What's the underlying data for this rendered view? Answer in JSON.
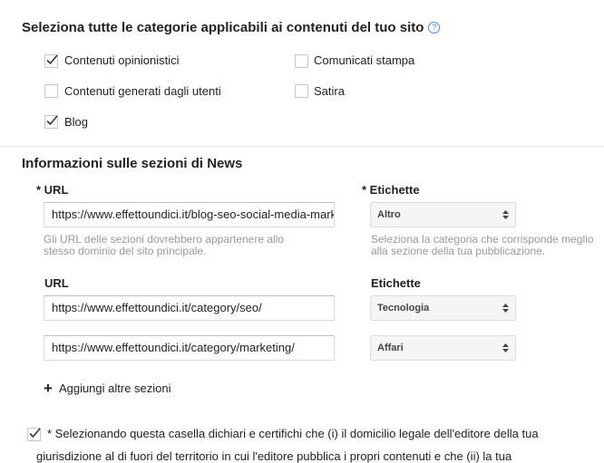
{
  "categories": {
    "heading": "Seleziona tutte le categorie applicabili ai contenuti del tuo sito",
    "help_glyph": "?",
    "options": [
      {
        "label": "Contenuti opinionistici",
        "checked": true
      },
      {
        "label": "Comunicati stampa",
        "checked": false
      },
      {
        "label": "Contenuti generati dagli utenti",
        "checked": false
      },
      {
        "label": "Satira",
        "checked": false
      },
      {
        "label": "Blog",
        "checked": true
      }
    ]
  },
  "news_sections": {
    "heading": "Informazioni sulle sezioni di News",
    "url_label_required": "* URL",
    "labels_label_required": "* Etichette",
    "url_hint": "Gli URL delle sezioni dovrebbero appartenere allo stesso dominio del sito principale.",
    "labels_hint": "Seleziona la categoria che corrisponde meglio alla sezione della tua pubblicazione.",
    "url_label": "URL",
    "labels_label": "Etichette",
    "rows": [
      {
        "url": "https://www.effettoundici.it/blog-seo-social-media-marketing/",
        "label": "Altro"
      },
      {
        "url": "https://www.effettoundici.it/category/seo/",
        "label": "Tecnologia"
      },
      {
        "url": "https://www.effettoundici.it/category/marketing/",
        "label": "Affari"
      }
    ],
    "add_more": "Aggiungi altre sezioni",
    "add_glyph": "+"
  },
  "agreement": {
    "checked": true,
    "text": "* Selezionando questa casella dichiari e certifichi che (i) il domicilio legale dell'editore della tua",
    "cutoff_text": "giurisdizione al di fuori del territorio in cui l'editore pubblica i propri contenuti e che (ii) la tua"
  },
  "colors": {
    "help_blue": "#4a86e8",
    "hint_gray": "#999999",
    "select_bg": "#f5f5f5"
  }
}
